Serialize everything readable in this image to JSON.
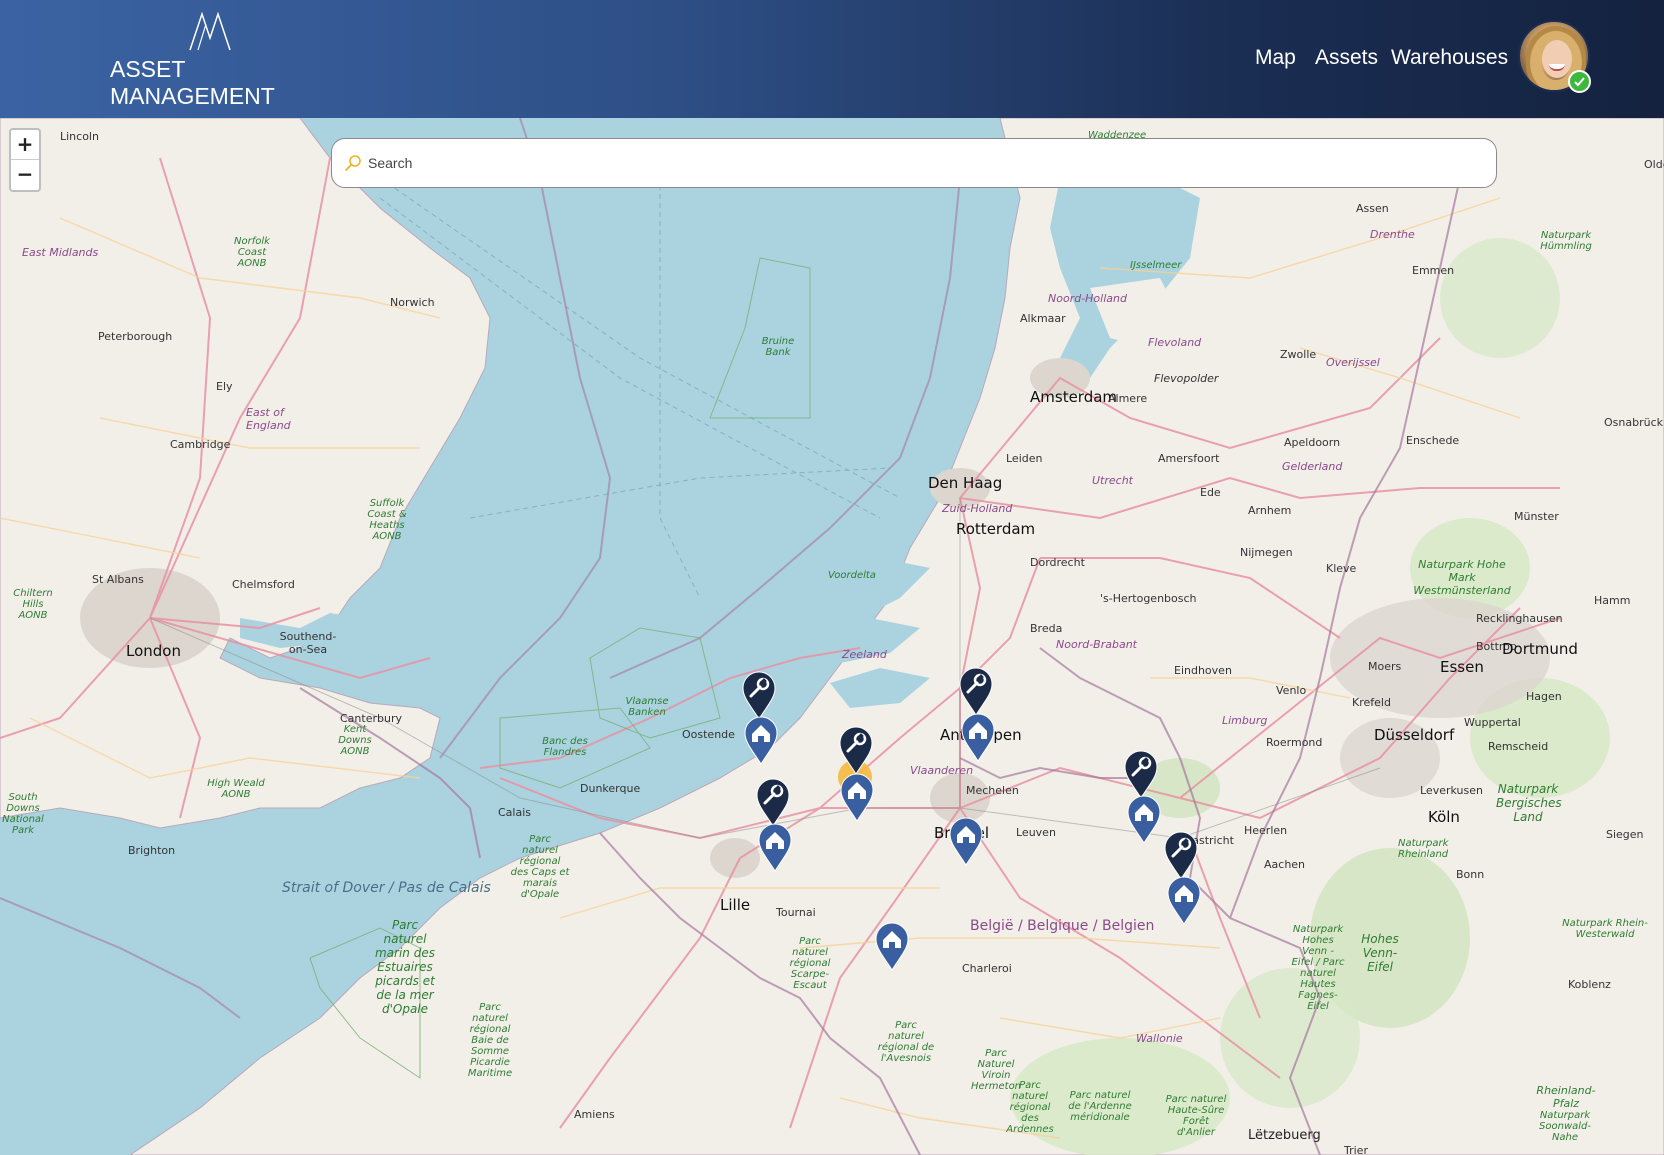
{
  "header": {
    "logo_text": "ASSET MANAGEMENT",
    "nav": [
      {
        "label": "Map"
      },
      {
        "label": "Assets"
      },
      {
        "label": "Warehouses"
      }
    ],
    "user_status": "online"
  },
  "search": {
    "placeholder": "Search",
    "value": ""
  },
  "zoom": {
    "in_label": "+",
    "out_label": "−"
  },
  "colors": {
    "header_gradient_start": "#3b63a3",
    "header_gradient_end": "#14223f",
    "warehouse_marker": "#3a5fa0",
    "maintenance_marker": "#1b2a47",
    "cluster_highlight": "#f4b840",
    "status_online": "#3db83d"
  },
  "markers": {
    "warehouse_icon": "house-icon",
    "maintenance_icon": "wrench-icon"
  },
  "map_labels": {
    "lincoln": "Lincoln",
    "east_midlands": "East Midlands",
    "norfolk_coast": "Norfolk Coast AONB",
    "norwich": "Norwich",
    "peterborough": "Peterborough",
    "ely": "Ely",
    "cambridge": "Cambridge",
    "east_of_england": "East of England",
    "suffolk": "Suffolk Coast & Heaths AONB",
    "st_albans": "St Albans",
    "chelmsford": "Chelmsford",
    "chiltern": "Chiltern Hills AONB",
    "london": "London",
    "southend": "Southend-on-Sea",
    "canterbury": "Canterbury",
    "kent_downs": "Kent Downs AONB",
    "high_weald": "High Weald AONB",
    "south_downs": "South Downs National Park",
    "brighton": "Brighton",
    "strait": "Strait of Dover / Pas de Calais",
    "bruine_bank": "Bruine Bank",
    "vlaamse_banken": "Vlaamse Banken",
    "banc_flandres": "Banc des Flandres",
    "calais": "Calais",
    "dunkerque": "Dunkerque",
    "oostende": "Oostende",
    "parc_caps": "Parc naturel régional des Caps et marais d'Opale",
    "parc_marin": "Parc naturel marin des Estuaires picards et de la mer d'Opale",
    "parc_baie_somme": "Parc naturel régional Baie de Somme Picardie Maritime",
    "lille": "Lille",
    "tournai": "Tournai",
    "parc_scarpe": "Parc naturel régional Scarpe-Escaut",
    "amiens": "Amiens",
    "parc_avesnois": "Parc naturel régional de l'Avesnois",
    "charleroi": "Charleroi",
    "belgie": "België / Belgique / Belgien",
    "parc_viroin": "Parc Naturel Viroin Hermeton",
    "parc_ardennes": "Parc naturel régional des Ardennes",
    "parc_ardenne_meridionale": "Parc naturel de l'Ardenne méridionale",
    "wallonie": "Wallonie",
    "parc_haute_sure": "Parc naturel Haute-Sûre Forêt d'Anlier",
    "letzebuerg": "Lëtzebuerg",
    "waddenzee": "Waddenzee",
    "assen": "Assen",
    "drenthe": "Drenthe",
    "emmen": "Emmen",
    "hummling": "Naturpark Hümmling",
    "ijsselmeer": "IJsselmeer",
    "noord_holland": "Noord-Holland",
    "alkmaar": "Alkmaar",
    "flevoland": "Flevoland",
    "flevopolder": "Flevopolder",
    "zwolle": "Zwolle",
    "overijssel": "Overijssel",
    "amsterdam": "Amsterdam",
    "almere": "Almere",
    "apeldoorn": "Apeldoorn",
    "enschede": "Enschede",
    "osnabruck": "Osnabrück",
    "leiden": "Leiden",
    "amersfoort": "Amersfoort",
    "gelderland": "Gelderland",
    "den_haag": "Den Haag",
    "utrecht": "Utrecht",
    "ede": "Ede",
    "zuid_holland": "Zuid-Holland",
    "rotterdam": "Rotterdam",
    "arnhem": "Arnhem",
    "munster": "Münster",
    "dordrecht": "Dordrecht",
    "nijmegen": "Nijmegen",
    "kleve": "Kleve",
    "hohe_mark": "Naturpark Hohe Mark Westmünsterland",
    "voordelta": "Voordelta",
    "hertogenbosch": "'s-Hertogenbosch",
    "recklinghausen": "Recklinghausen",
    "hamm": "Hamm",
    "breda": "Breda",
    "noord_brabant": "Noord-Brabant",
    "bottrop": "Bottrop",
    "dortmund": "Dortmund",
    "zeeland": "Zeeland",
    "eindhoven": "Eindhoven",
    "moers": "Moers",
    "essen": "Essen",
    "venlo": "Venlo",
    "krefeld": "Krefeld",
    "hagen": "Hagen",
    "antwerpen": "Antwerpen",
    "limburg": "Limburg",
    "wuppertal": "Wuppertal",
    "dusseldorf": "Düsseldorf",
    "roermond": "Roermond",
    "remscheid": "Remscheid",
    "vlaanderen": "Vlaanderen",
    "mechelen": "Mechelen",
    "leverkusen": "Leverkusen",
    "bergisches_land": "Naturpark Bergisches Land",
    "heerlen": "Heerlen",
    "koln": "Köln",
    "brussel": "Brussel",
    "leuven": "Leuven",
    "maastricht": "Maastricht",
    "aachen": "Aachen",
    "rheinland": "Naturpark Rheinland",
    "siegen": "Siegen",
    "bonn": "Bonn",
    "hohes_venn": "Hohes Venn-Eifel",
    "hohes_venn_parc": "Naturpark Hohes Venn - Eifel / Parc naturel Hautes Fagnes-Eifel",
    "rhein_westerwald": "Naturpark Rhein-Westerwald",
    "koblenz": "Koblenz",
    "rheinland_pfalz": "Rheinland-Pfalz",
    "soonwald": "Naturpark Soonwald-Nahe",
    "trier": "Trier",
    "oldenburg": "Olde"
  }
}
